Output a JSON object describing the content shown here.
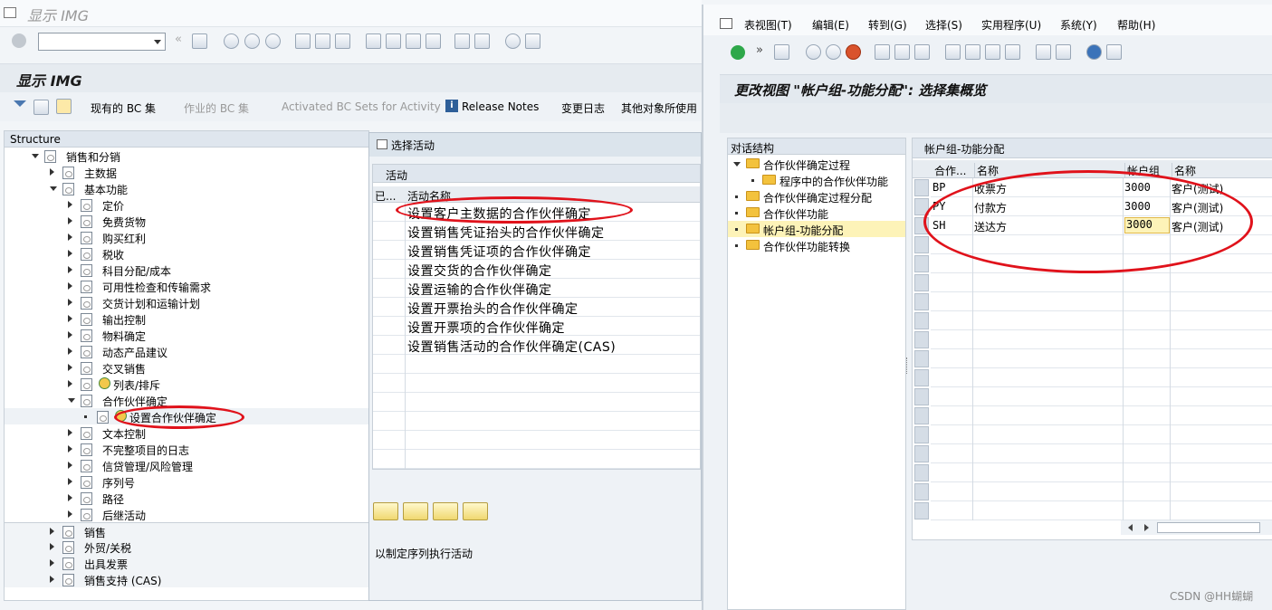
{
  "left_window": {
    "title": "显示 IMG",
    "heading": "显示 IMG",
    "toolbar_buttons": {
      "existing_bc": "现有的 BC 集",
      "bc_for_activity": "作业的 BC 集",
      "activated_bc": "Activated BC Sets for Activity",
      "release_notes": "Release Notes",
      "change_log": "变更日志",
      "other_usage": "其他对象所使用"
    },
    "structure_header": "Structure",
    "tree": [
      {
        "label": "销售和分销"
      },
      {
        "label": "主数据"
      },
      {
        "label": "基本功能"
      },
      {
        "label": "定价"
      },
      {
        "label": "免费货物"
      },
      {
        "label": "购买红利"
      },
      {
        "label": "税收"
      },
      {
        "label": "科目分配/成本"
      },
      {
        "label": "可用性检查和传输需求"
      },
      {
        "label": "交货计划和运输计划"
      },
      {
        "label": "输出控制"
      },
      {
        "label": "物料确定"
      },
      {
        "label": "动态产品建议"
      },
      {
        "label": "交叉销售"
      },
      {
        "label": "列表/排斥"
      },
      {
        "label": "合作伙伴确定"
      },
      {
        "label": "设置合作伙伴确定"
      },
      {
        "label": "文本控制"
      },
      {
        "label": "不完整项目的日志"
      },
      {
        "label": "信贷管理/风险管理"
      },
      {
        "label": "序列号"
      },
      {
        "label": "路径"
      },
      {
        "label": "后继活动"
      },
      {
        "label": "销售"
      },
      {
        "label": "外贸/关税"
      },
      {
        "label": "出具发票"
      },
      {
        "label": "销售支持 (CAS)"
      }
    ]
  },
  "dialog": {
    "title": "选择活动",
    "section_header": "活动",
    "col_done": "已...",
    "col_name": "活动名称",
    "rows": [
      "设置客户主数据的合作伙伴确定",
      "设置销售凭证抬头的合作伙伴确定",
      "设置销售凭证项的合作伙伴确定",
      "设置交货的合作伙伴确定",
      "设置运输的合作伙伴确定",
      "设置开票抬头的合作伙伴确定",
      "设置开票项的合作伙伴确定",
      "设置销售活动的合作伙伴确定(CAS)"
    ],
    "footer_text": "以制定序列执行活动"
  },
  "right_window": {
    "menu": [
      "表视图(T)",
      "编辑(E)",
      "转到(G)",
      "选择(S)",
      "实用程序(U)",
      "系统(Y)",
      "帮助(H)"
    ],
    "heading": "更改视图 \"帐户组-功能分配\": 选择集概览",
    "nav_header": "对话结构",
    "nav_items": [
      {
        "label": "合作伙伴确定过程"
      },
      {
        "label": "程序中的合作伙伴功能"
      },
      {
        "label": "合作伙伴确定过程分配"
      },
      {
        "label": "合作伙伴功能"
      },
      {
        "label": "帐户组-功能分配"
      },
      {
        "label": "合作伙伴功能转换"
      }
    ],
    "table_title": "帐户组-功能分配",
    "columns": [
      "合作...",
      "名称",
      "帐户组",
      "名称"
    ],
    "rows": [
      {
        "func": "BP",
        "name": "收票方",
        "group": "3000",
        "group_name": "客户(测试)"
      },
      {
        "func": "PY",
        "name": "付款方",
        "group": "3000",
        "group_name": "客户(测试)"
      },
      {
        "func": "SH",
        "name": "送达方",
        "group": "3000",
        "group_name": "客户(测试)"
      }
    ]
  },
  "watermark": "CSDN @HH蝴蝴",
  "colors": {
    "accent_red": "#e0121b",
    "selection_yellow": "#fdf3b8",
    "header_blue": "#dde6ee"
  }
}
